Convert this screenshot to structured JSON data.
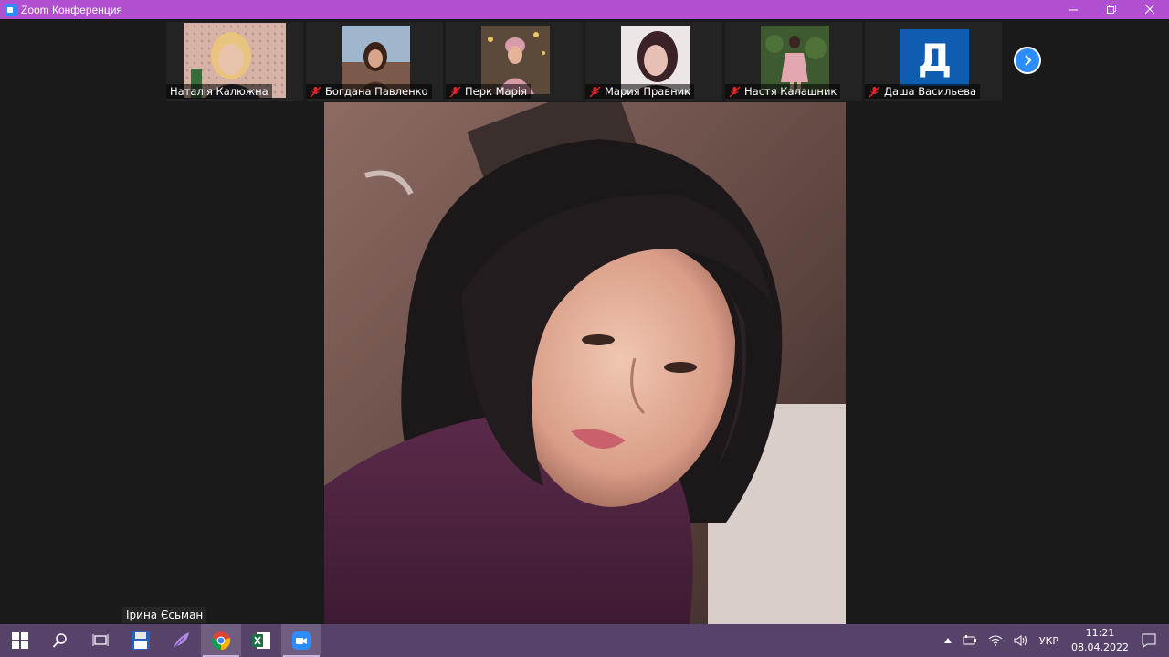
{
  "window": {
    "title": "Zoom Конференция",
    "minimize": "—",
    "maximize": "❐",
    "close": "✕"
  },
  "participants": [
    {
      "name": "Наталія Калюжна",
      "muted": false
    },
    {
      "name": "Богдана Павленко",
      "muted": true
    },
    {
      "name": "Перк Марія",
      "muted": true
    },
    {
      "name": "Мария Правник",
      "muted": true
    },
    {
      "name": "Настя Калашник",
      "muted": true
    },
    {
      "name": "Даша Васильева",
      "muted": true,
      "avatar_letter": "Д"
    }
  ],
  "active_speaker": {
    "name": "Ірина Єсьман"
  },
  "taskbar": {
    "language": "УКР",
    "time": "11:21",
    "date": "08.04.2022"
  },
  "colors": {
    "titlebar": "#b04fd0",
    "taskbar": "#57426a",
    "accent": "#2d8cff",
    "mute": "#e02828"
  }
}
